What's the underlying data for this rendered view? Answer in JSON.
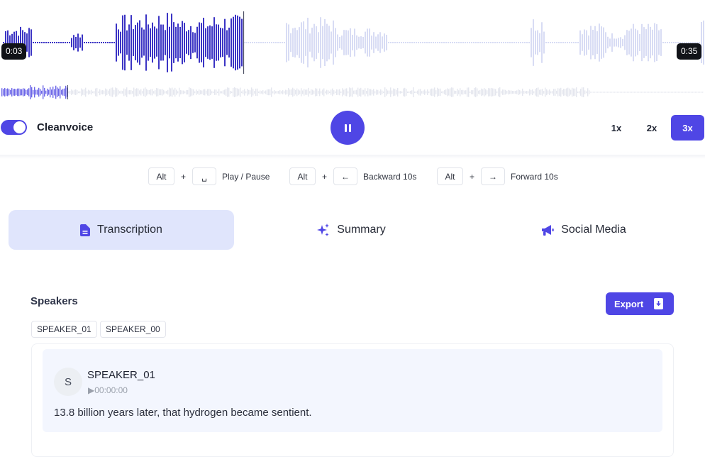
{
  "player": {
    "current_time": "0:03",
    "total_time": "0:35",
    "progress": 0.345,
    "played_color": "#3b34c4",
    "unplayed_color": "#d8dcf4"
  },
  "cleanvoice": {
    "label": "Cleanvoice",
    "enabled": true
  },
  "speeds": [
    {
      "label": "1x",
      "active": false
    },
    {
      "label": "2x",
      "active": false
    },
    {
      "label": "3x",
      "active": true
    }
  ],
  "shortcuts": [
    {
      "key": "Alt",
      "plus": "+",
      "glyph": "␣",
      "label": "Play / Pause"
    },
    {
      "key": "Alt",
      "plus": "+",
      "glyph": "←",
      "label": "Backward 10s"
    },
    {
      "key": "Alt",
      "plus": "+",
      "glyph": "→",
      "label": "Forward 10s"
    }
  ],
  "tabs": [
    {
      "label": "Transcription",
      "icon": "document-icon",
      "active": true
    },
    {
      "label": "Summary",
      "icon": "sparkles-icon",
      "active": false
    },
    {
      "label": "Social Media",
      "icon": "megaphone-icon",
      "active": false
    }
  ],
  "speakers": {
    "title": "Speakers",
    "export_label": "Export",
    "chips": [
      "SPEAKER_01",
      "SPEAKER_00"
    ]
  },
  "segments": [
    {
      "avatar_initial": "S",
      "speaker": "SPEAKER_01",
      "timestamp": "▶00:00:00",
      "text": "13.8 billion years later, that hydrogen became sentient."
    }
  ],
  "colors": {
    "accent": "#4f46e5",
    "tab_active_bg": "#e0e5fc"
  }
}
